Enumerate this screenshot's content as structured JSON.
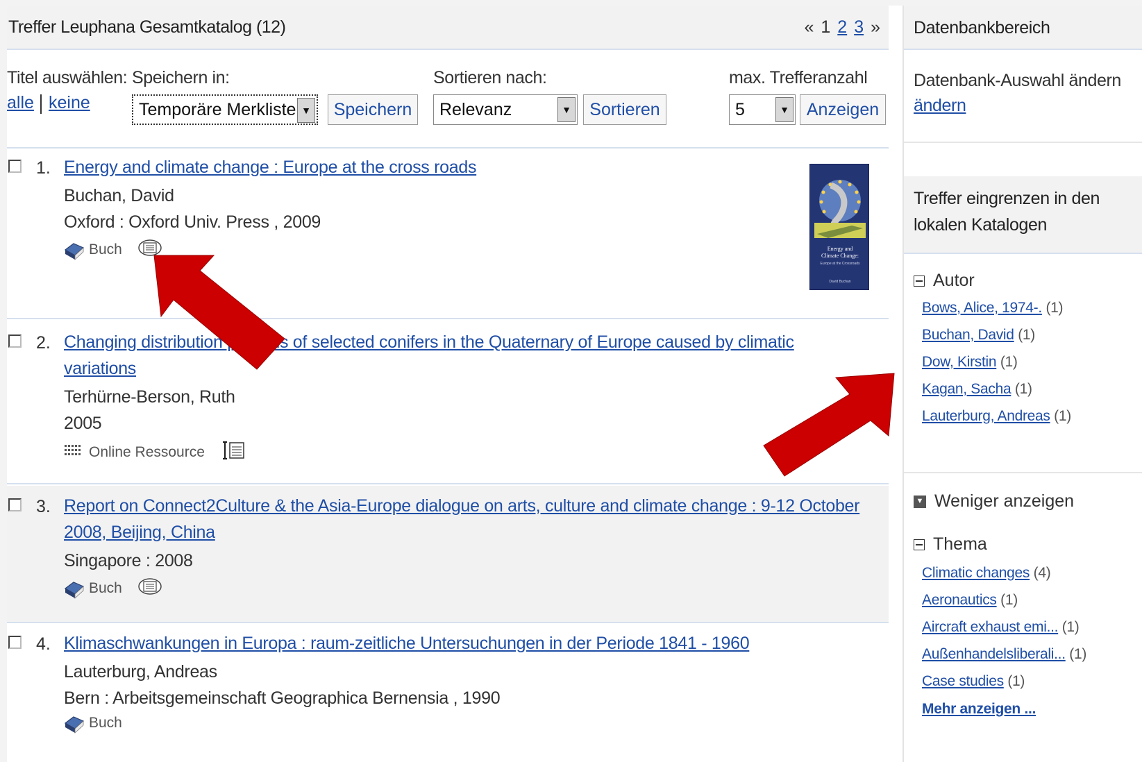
{
  "header": {
    "title": "Treffer Leuphana Gesamtkatalog (12)",
    "pager": {
      "prev": "«",
      "current": "1",
      "pages": [
        "2",
        "3"
      ],
      "next": "»"
    }
  },
  "controls": {
    "select_titles_label": "Titel auswählen:",
    "all_link": "alle",
    "none_link": "keine",
    "save_in_label": "Speichern in:",
    "save_in_value": "Temporäre Merkliste",
    "save_button": "Speichern",
    "sort_label": "Sortieren nach:",
    "sort_value": "Relevanz",
    "sort_button": "Sortieren",
    "max_label": "max. Trefferanzahl",
    "max_value": "5",
    "show_button": "Anzeigen"
  },
  "results": [
    {
      "number": "1.",
      "title_line1": "Energy and climate change : Europe at the cross roads",
      "author": "Buchan, David",
      "publisher": "Oxford :  Oxford Univ. Press ,  2009",
      "media": "Buch",
      "cover_text": [
        "Energy and",
        "Climate Change:",
        "Europe at the Crossroads",
        "David Buchan"
      ]
    },
    {
      "number": "2.",
      "title_line1": "Changing distribution patterns of selected conifers in the Quaternary of Europe caused by climatic",
      "title_line2": "variations",
      "author": "Terhürne-Berson, Ruth",
      "publisher": "2005",
      "media": "Online Ressource"
    },
    {
      "number": "3.",
      "title_line1": "Report on Connect2Culture & the Asia-Europe dialogue on arts, culture and climate change : 9-12 October",
      "title_line2": "2008, Beijing, China",
      "publisher": "Singapore :  2008",
      "media": "Buch"
    },
    {
      "number": "4.",
      "title_line1": "Klimaschwankungen in Europa : raum-zeitliche Untersuchungen in der Periode 1841 - 1960",
      "author": "Lauterburg, Andreas",
      "publisher": "Bern :  Arbeitsgemeinschaft Geographica Bernensia ,  1990",
      "media": "Buch"
    }
  ],
  "sidebar": {
    "db_head": "Datenbankbereich",
    "db_text": "Datenbank-Auswahl ändern",
    "db_link": "ändern",
    "narrow_head_1": "Treffer eingrenzen in den",
    "narrow_head_2": "lokalen Katalogen",
    "author_facet": {
      "title": "Autor",
      "items": [
        {
          "label": "Bows, Alice, 1974-.",
          "count": "(1)"
        },
        {
          "label": "Buchan, David",
          "count": "(1)"
        },
        {
          "label": "Dow, Kirstin",
          "count": "(1)"
        },
        {
          "label": "Kagan, Sacha",
          "count": "(1)"
        },
        {
          "label": "Lauterburg, Andreas",
          "count": "(1)"
        }
      ]
    },
    "less_label": "Weniger anzeigen",
    "topic_facet": {
      "title": "Thema",
      "items": [
        {
          "label": "Climatic changes",
          "count": "(4)"
        },
        {
          "label": "Aeronautics",
          "count": "(1)"
        },
        {
          "label": "Aircraft exhaust emi...",
          "count": "(1)"
        },
        {
          "label": "Außenhandelsliberali...",
          "count": "(1)"
        },
        {
          "label": "Case studies",
          "count": "(1)"
        }
      ],
      "more": "Mehr anzeigen ..."
    }
  },
  "colors": {
    "link": "#1f4ea6",
    "arrow": "#cc0000",
    "header_bg": "#f2f2f2",
    "separator": "#d5e0ee"
  }
}
